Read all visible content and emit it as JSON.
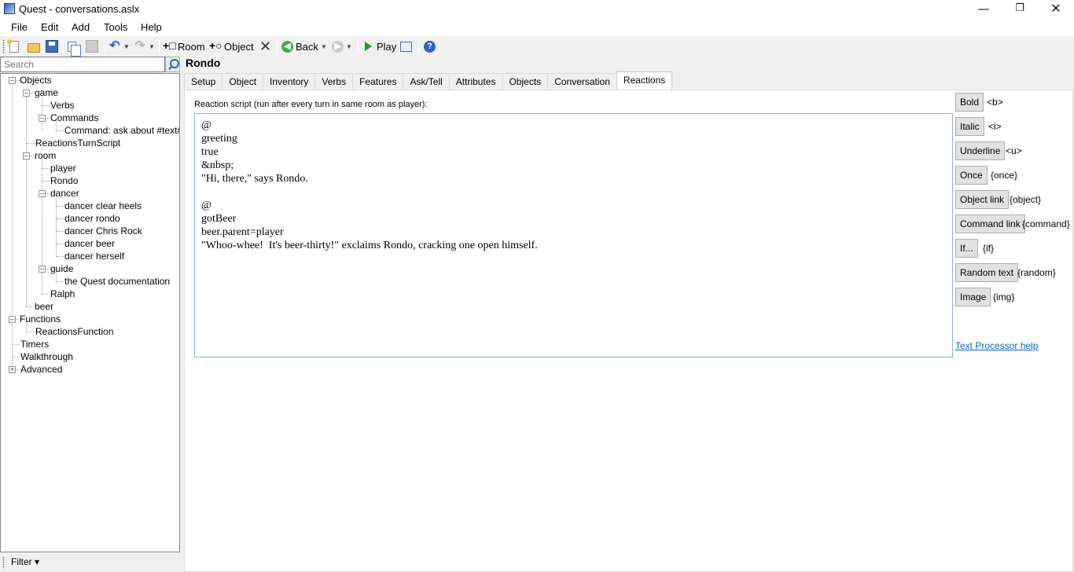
{
  "window": {
    "title": "Quest - conversations.aslx"
  },
  "menu": [
    {
      "label": "File"
    },
    {
      "label": "Edit"
    },
    {
      "label": "Add"
    },
    {
      "label": "Tools"
    },
    {
      "label": "Help"
    }
  ],
  "toolbar": {
    "room_label": "Room",
    "object_label": "Object",
    "back_label": "Back",
    "play_label": "Play"
  },
  "search": {
    "placeholder": "Search"
  },
  "tree": {
    "objects": "Objects",
    "game": "game",
    "verbs": "Verbs",
    "commands": "Commands",
    "command_ask": "Command: ask about #text#",
    "reactions_turn_script": "ReactionsTurnScript",
    "room": "room",
    "player": "player",
    "rondo": "Rondo",
    "dancer": "dancer",
    "dancer_clear_heels": "dancer clear heels",
    "dancer_rondo": "dancer rondo",
    "dancer_chris_rock": "dancer Chris Rock",
    "dancer_beer": "dancer beer",
    "dancer_herself": "dancer herself",
    "guide": "guide",
    "quest_doc": "the Quest documentation",
    "ralph": "Ralph",
    "beer": "beer",
    "functions": "Functions",
    "reactions_function": "ReactionsFunction",
    "timers": "Timers",
    "walkthrough": "Walkthrough",
    "advanced": "Advanced"
  },
  "filter": {
    "label": "Filter ▾"
  },
  "editor": {
    "object_name": "Rondo",
    "tabs": [
      "Setup",
      "Object",
      "Inventory",
      "Verbs",
      "Features",
      "Ask/Tell",
      "Attributes",
      "Objects",
      "Conversation",
      "Reactions"
    ],
    "active_tab": "Reactions",
    "script_label": "Reaction script (run after every turn in same room as player):",
    "script_text": "@\ngreeting\ntrue\n&nbsp;\n\"Hi, there,\" says Rondo.\n\n@\ngotBeer\nbeer.parent=player\n\"Whoo-whee!  It's beer-thirty!\" exclaims Rondo, cracking one open himself."
  },
  "formatting": [
    {
      "button": "Bold",
      "tag": "<b>"
    },
    {
      "button": "Italic",
      "tag": "<i>"
    },
    {
      "button": "Underline",
      "tag": "<u>"
    },
    {
      "button": "Once",
      "tag": "{once}"
    },
    {
      "button": "Object link",
      "tag": "{object}"
    },
    {
      "button": "Command link",
      "tag": "{command}"
    },
    {
      "button": "If...",
      "tag": "{if}"
    },
    {
      "button": "Random text",
      "tag": "{random}"
    },
    {
      "button": "Image",
      "tag": "{img}"
    }
  ],
  "help_link": "Text Processor help"
}
